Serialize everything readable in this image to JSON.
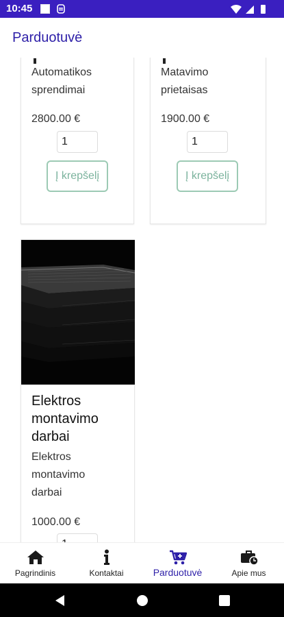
{
  "status_bar": {
    "time": "10:45"
  },
  "app_bar": {
    "title": "Parduotuvė"
  },
  "products": [
    {
      "description_line1": "Automatikos",
      "description_line2": "sprendimai",
      "price": "2800.00 €",
      "quantity": "1",
      "cart_label": "Į krepšelį"
    },
    {
      "description_line1": "Matavimo",
      "description_line2": "prietaisas",
      "price": "1900.00 €",
      "quantity": "1",
      "cart_label": "Į krepšelį"
    },
    {
      "title_line1": "Elektros",
      "title_line2": "montavimo",
      "title_line3": "darbai",
      "description_line1": "Elektros",
      "description_line2": "montavimo",
      "description_line3": "darbai",
      "price": "1000.00 €",
      "quantity": "1"
    }
  ],
  "bottom_nav": {
    "items": [
      {
        "label": "Pagrindinis",
        "icon": "home-icon"
      },
      {
        "label": "Kontaktai",
        "icon": "info-icon"
      },
      {
        "label": "Parduotuvė",
        "icon": "cart-add-icon"
      },
      {
        "label": "Apie mus",
        "icon": "briefcase-clock-icon"
      }
    ],
    "active_index": 2
  },
  "colors": {
    "status_bar": "#3a1fc0",
    "accent": "#2d1fa8",
    "cart_button": "#7bb39d"
  }
}
